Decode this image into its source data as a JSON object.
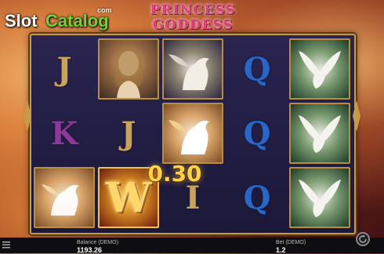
{
  "watermark": {
    "part1": "Slot",
    "part2": "Catalog",
    "suffix": "com"
  },
  "logo": {
    "line1": "PRINCESS",
    "line2": "GODDESS"
  },
  "reels": {
    "col1": [
      "J",
      "K",
      "pegasus"
    ],
    "col2": [
      "princess",
      "J",
      "wild"
    ],
    "col3": [
      "pegasus",
      "pegasus",
      "I"
    ],
    "col4": [
      "Q",
      "Q",
      "Q"
    ],
    "col5": [
      "dove",
      "dove",
      "dove"
    ],
    "wild_letter": "W",
    "glyph_I": "I"
  },
  "win_amount": "0.30",
  "footer": {
    "balance_label": "Balance (DEMO)",
    "balance_value": "1193.26",
    "bet_label": "Bet (DEMO)",
    "bet_value": "1.2"
  },
  "colors": {
    "frame": "#c79a4a",
    "win": "#ffd24a",
    "watermark_green": "#74d13b"
  }
}
